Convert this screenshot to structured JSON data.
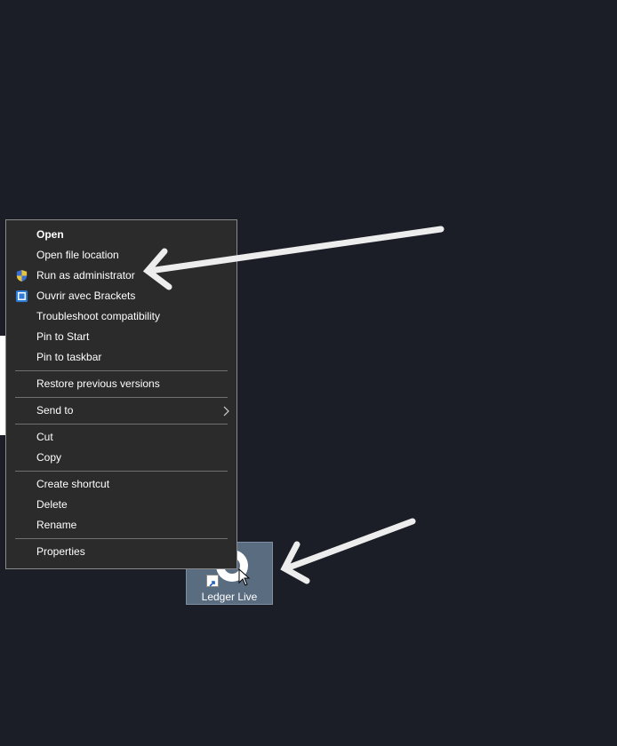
{
  "context_menu": {
    "items": [
      {
        "label": "Open"
      },
      {
        "label": "Open file location"
      },
      {
        "label": "Run as administrator",
        "icon": "uac-shield-icon"
      },
      {
        "label": "Ouvrir avec Brackets",
        "icon": "brackets-icon"
      },
      {
        "label": "Troubleshoot compatibility"
      },
      {
        "label": "Pin to Start"
      },
      {
        "label": "Pin to taskbar"
      },
      {
        "label": "Restore previous versions"
      },
      {
        "label": "Send to",
        "icon": "chevron-right-icon"
      },
      {
        "label": "Cut"
      },
      {
        "label": "Copy"
      },
      {
        "label": "Create shortcut"
      },
      {
        "label": "Delete"
      },
      {
        "label": "Rename"
      },
      {
        "label": "Properties"
      }
    ]
  },
  "desktop_icon": {
    "label": "Ledger Live",
    "icon": "ledger-live-icon"
  },
  "colors": {
    "background": "#1b1e27",
    "menu_bg": "#2b2b2b",
    "icon_selection": "#5a6c80",
    "annotation_arrow": "#ededed"
  }
}
